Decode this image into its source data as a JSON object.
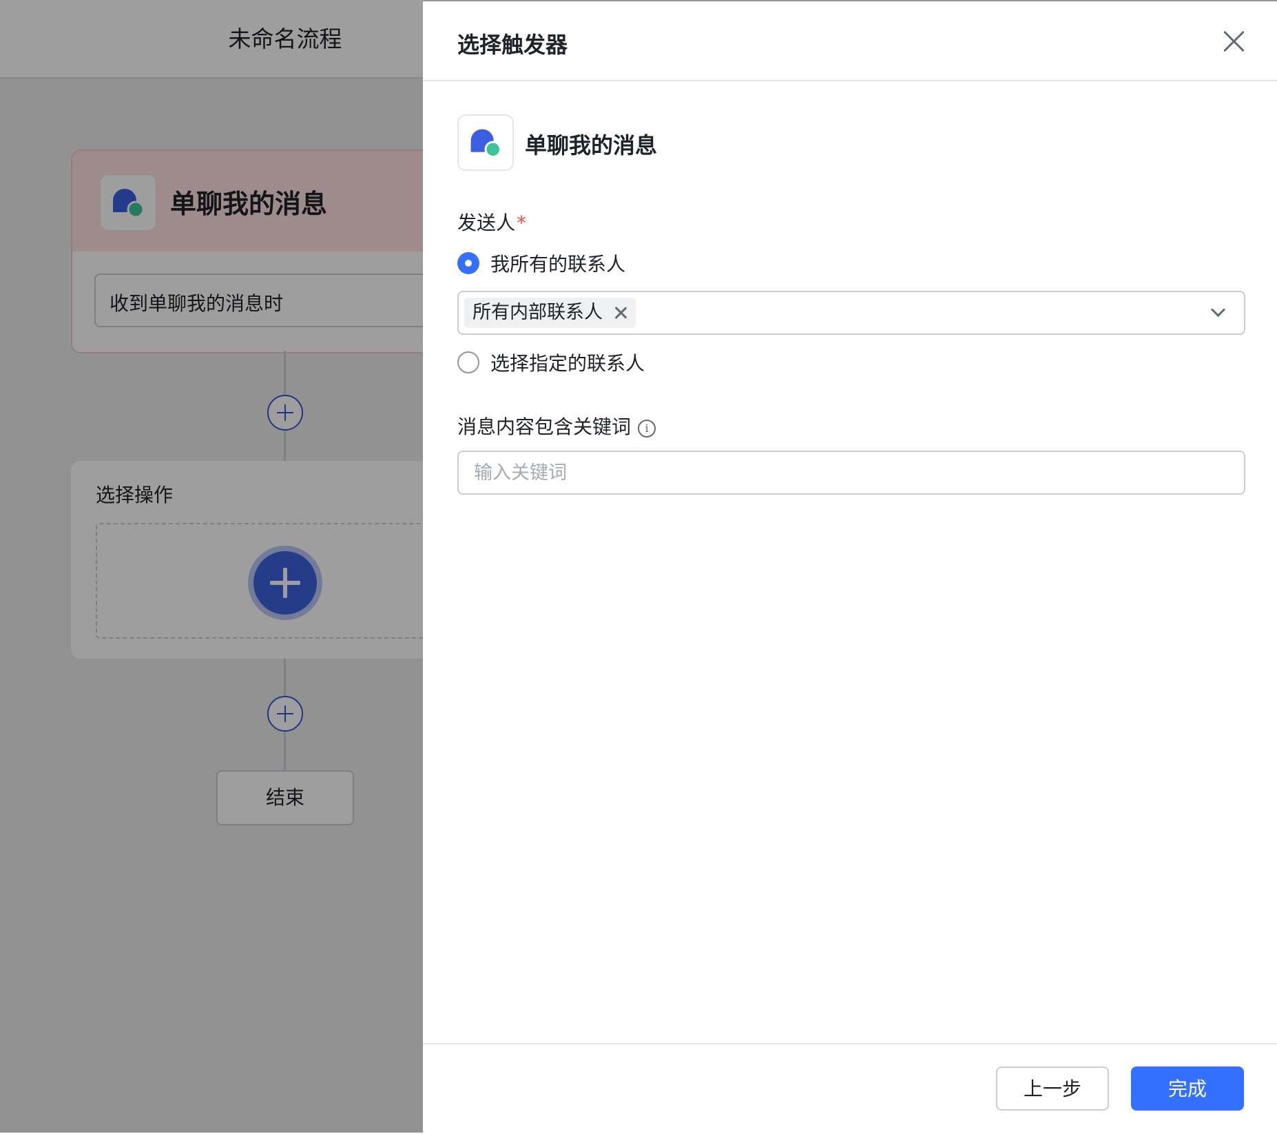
{
  "canvas": {
    "title": "未命名流程",
    "trigger_card": {
      "title": "单聊我的消息",
      "condition": "收到单聊我的消息时",
      "icon": "chat-bubbles-icon"
    },
    "action_card": {
      "title": "选择操作"
    },
    "end_label": "结束"
  },
  "drawer": {
    "title": "选择触发器",
    "selected_trigger": {
      "name": "单聊我的消息",
      "icon": "chat-bubbles-icon"
    },
    "sender": {
      "label": "发送人",
      "required_mark": "*",
      "options": [
        {
          "label": "我所有的联系人",
          "checked": true
        },
        {
          "label": "选择指定的联系人",
          "checked": false
        }
      ],
      "selected_tags": [
        "所有内部联系人"
      ]
    },
    "keywords": {
      "label": "消息内容包含关键词",
      "info_glyph": "i",
      "placeholder": "输入关键词",
      "value": ""
    },
    "footer": {
      "prev_label": "上一步",
      "done_label": "完成"
    }
  },
  "colors": {
    "primary": "#3370ff",
    "flow_accent": "#3358d4",
    "required": "#f54a45",
    "trigger_header_bg": "#ffe2e2",
    "icon_blue": "#3b5fe0",
    "icon_green": "#3fc39a"
  }
}
